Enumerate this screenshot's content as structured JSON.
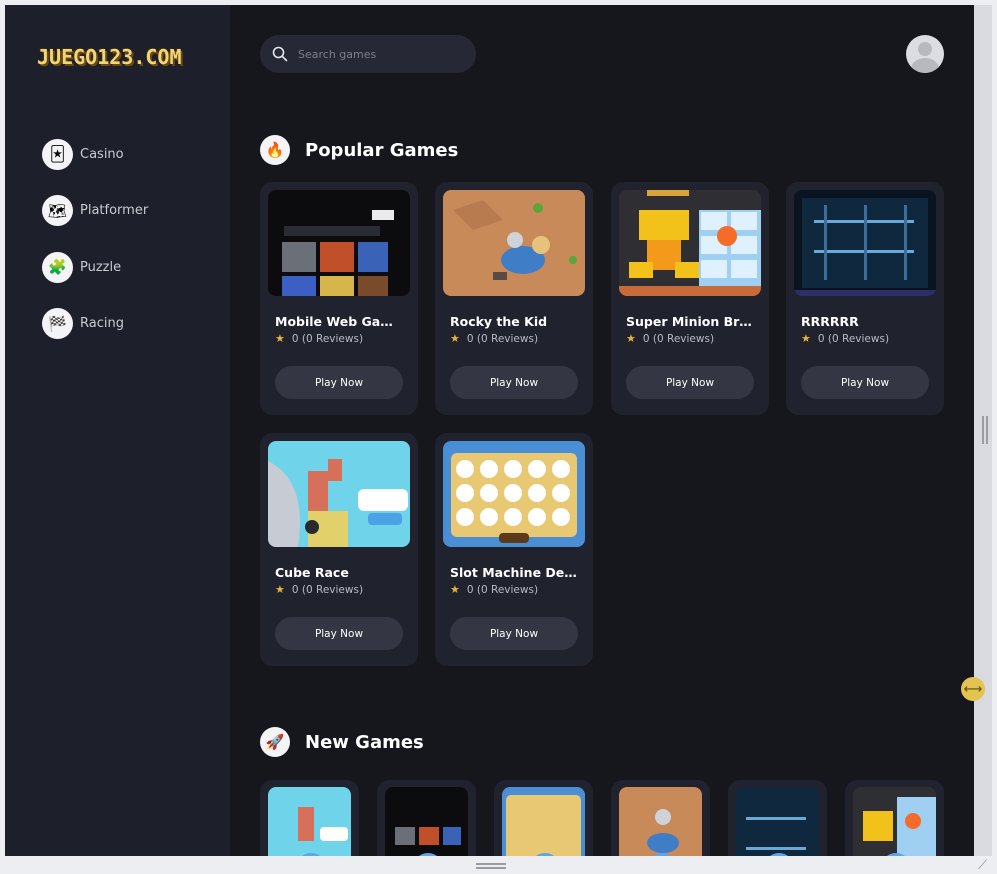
{
  "logo": "JUEGO123.COM",
  "sidebar": {
    "items": [
      {
        "label": "Casino",
        "icon": "cards-icon"
      },
      {
        "label": "Platformer",
        "icon": "map-icon"
      },
      {
        "label": "Puzzle",
        "icon": "puzzle-icon"
      },
      {
        "label": "Racing",
        "icon": "checkered-flag-icon"
      }
    ]
  },
  "search": {
    "placeholder": "Search games"
  },
  "popular": {
    "title": "Popular Games",
    "games": [
      {
        "title": "Mobile Web Game Room",
        "rating": "0",
        "reviews": "(0 Reviews)",
        "button": "Play Now"
      },
      {
        "title": "Rocky the Kid",
        "rating": "0",
        "reviews": "(0 Reviews)",
        "button": "Play Now"
      },
      {
        "title": "Super Minion Bros.",
        "rating": "0",
        "reviews": "(0 Reviews)",
        "button": "Play Now"
      },
      {
        "title": "RRRRRR",
        "rating": "0",
        "reviews": "(0 Reviews)",
        "button": "Play Now"
      },
      {
        "title": "Cube Race",
        "rating": "0",
        "reviews": "(0 Reviews)",
        "button": "Play Now"
      },
      {
        "title": "Slot Machine Deluxe",
        "rating": "0",
        "reviews": "(0 Reviews)",
        "button": "Play Now"
      }
    ]
  },
  "new_games": {
    "title": "New Games"
  },
  "colors": {
    "background": "#16161d",
    "sidebar": "#1d1f2a",
    "card": "#20222e",
    "button": "#343644",
    "star": "#e8b23a"
  }
}
